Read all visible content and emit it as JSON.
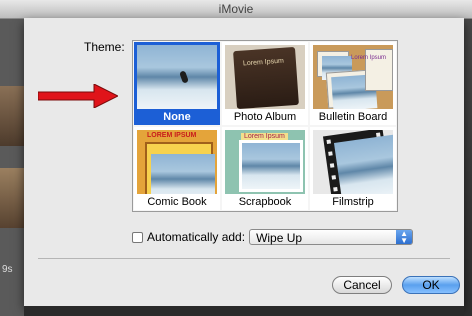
{
  "window": {
    "title": "iMovie"
  },
  "background": {
    "timecode": "9s"
  },
  "dialog": {
    "theme_label": "Theme:",
    "themes": [
      {
        "label": "None",
        "selected": true
      },
      {
        "label": "Photo Album",
        "selected": false,
        "cover_text": "Lorem Ipsum"
      },
      {
        "label": "Bulletin Board",
        "selected": false,
        "note_text": "Lorem Ipsum"
      },
      {
        "label": "Comic Book",
        "selected": false,
        "banner_text": "LOREM IPSUM"
      },
      {
        "label": "Scrapbook",
        "selected": false,
        "tag_text": "Lorem Ipsum"
      },
      {
        "label": "Filmstrip",
        "selected": false
      }
    ],
    "auto_add_label": "Automatically add:",
    "auto_add_checked": false,
    "auto_add_value": "Wipe Up",
    "cancel_label": "Cancel",
    "ok_label": "OK"
  },
  "colors": {
    "selection": "#1c5fd6",
    "arrow": "#e0141a",
    "ok_button": "#5aa0ee"
  },
  "icons": {
    "pointer": "red-arrow-icon",
    "dropdown": "chevron-updown-icon"
  }
}
